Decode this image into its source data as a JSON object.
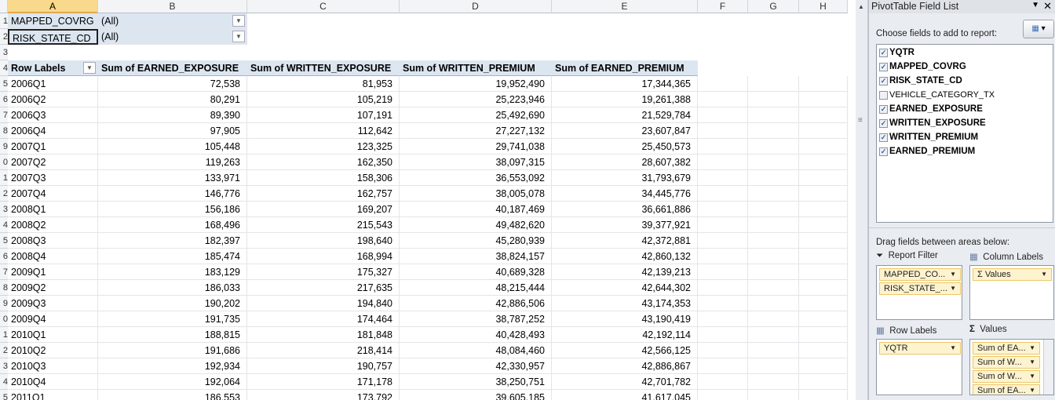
{
  "columns": [
    "A",
    "B",
    "C",
    "D",
    "E",
    "F",
    "G",
    "H"
  ],
  "filters": [
    {
      "field": "MAPPED_COVRG",
      "value": "(All)"
    },
    {
      "field": "RISK_STATE_CD",
      "value": "(All)"
    }
  ],
  "pivot_headers": [
    "Row Labels",
    "Sum of EARNED_EXPOSURE",
    "Sum of WRITTEN_EXPOSURE",
    "Sum of WRITTEN_PREMIUM",
    "Sum of EARNED_PREMIUM"
  ],
  "rows": [
    [
      "2006Q1",
      "72,538",
      "81,953",
      "19,952,490",
      "17,344,365"
    ],
    [
      "2006Q2",
      "80,291",
      "105,219",
      "25,223,946",
      "19,261,388"
    ],
    [
      "2006Q3",
      "89,390",
      "107,191",
      "25,492,690",
      "21,529,784"
    ],
    [
      "2006Q4",
      "97,905",
      "112,642",
      "27,227,132",
      "23,607,847"
    ],
    [
      "2007Q1",
      "105,448",
      "123,325",
      "29,741,038",
      "25,450,573"
    ],
    [
      "2007Q2",
      "119,263",
      "162,350",
      "38,097,315",
      "28,607,382"
    ],
    [
      "2007Q3",
      "133,971",
      "158,306",
      "36,553,092",
      "31,793,679"
    ],
    [
      "2007Q4",
      "146,776",
      "162,757",
      "38,005,078",
      "34,445,776"
    ],
    [
      "2008Q1",
      "156,186",
      "169,207",
      "40,187,469",
      "36,661,886"
    ],
    [
      "2008Q2",
      "168,496",
      "215,543",
      "49,482,620",
      "39,377,921"
    ],
    [
      "2008Q3",
      "182,397",
      "198,640",
      "45,280,939",
      "42,372,881"
    ],
    [
      "2008Q4",
      "185,474",
      "168,994",
      "38,824,157",
      "42,860,132"
    ],
    [
      "2009Q1",
      "183,129",
      "175,327",
      "40,689,328",
      "42,139,213"
    ],
    [
      "2009Q2",
      "186,033",
      "217,635",
      "48,215,444",
      "42,644,302"
    ],
    [
      "2009Q3",
      "190,202",
      "194,840",
      "42,886,506",
      "43,174,353"
    ],
    [
      "2009Q4",
      "191,735",
      "174,464",
      "38,787,252",
      "43,190,419"
    ],
    [
      "2010Q1",
      "188,815",
      "181,848",
      "40,428,493",
      "42,192,114"
    ],
    [
      "2010Q2",
      "191,686",
      "218,414",
      "48,084,460",
      "42,566,125"
    ],
    [
      "2010Q3",
      "192,934",
      "190,757",
      "42,330,957",
      "42,886,867"
    ],
    [
      "2010Q4",
      "192,064",
      "171,178",
      "38,250,751",
      "42,701,782"
    ],
    [
      "2011Q1",
      "186,553",
      "173,792",
      "39,605,185",
      "41,617,045"
    ]
  ],
  "field_list": {
    "title": "PivotTable Field List",
    "choose_label": "Choose fields to add to report:",
    "fields": [
      {
        "name": "YQTR",
        "checked": true
      },
      {
        "name": "MAPPED_COVRG",
        "checked": true
      },
      {
        "name": "RISK_STATE_CD",
        "checked": true
      },
      {
        "name": "VEHICLE_CATEGORY_TX",
        "checked": false
      },
      {
        "name": "EARNED_EXPOSURE",
        "checked": true
      },
      {
        "name": "WRITTEN_EXPOSURE",
        "checked": true
      },
      {
        "name": "WRITTEN_PREMIUM",
        "checked": true
      },
      {
        "name": "EARNED_PREMIUM",
        "checked": true
      }
    ],
    "drag_label": "Drag fields between areas below:",
    "report_filter_label": "Report Filter",
    "column_labels_label": "Column Labels",
    "row_labels_label": "Row Labels",
    "values_label": "Values",
    "report_filter_items": [
      "MAPPED_CO...",
      "RISK_STATE_..."
    ],
    "column_items": [
      "Values"
    ],
    "row_items": [
      "YQTR"
    ],
    "value_items": [
      "Sum of EA...",
      "Sum of W...",
      "Sum of W...",
      "Sum of EA..."
    ]
  }
}
